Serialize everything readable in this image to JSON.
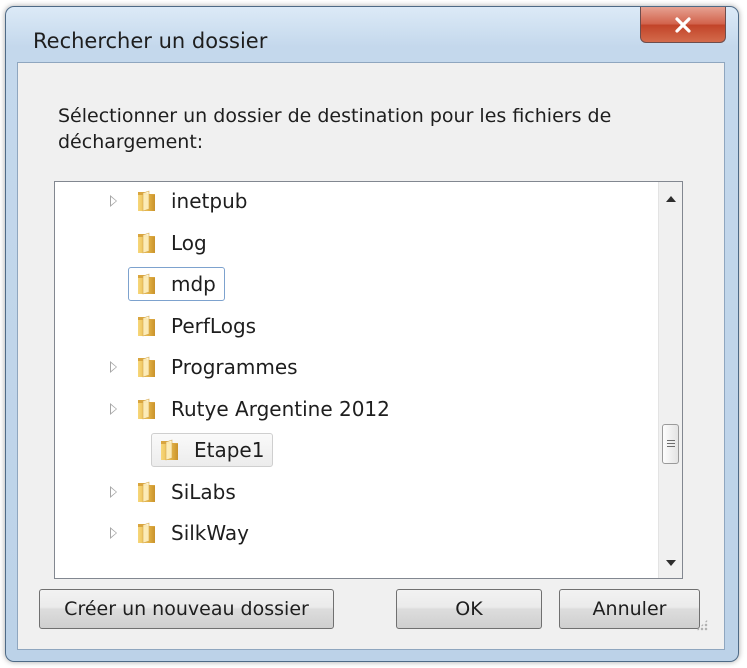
{
  "window": {
    "title": "Rechercher un dossier",
    "close_label": "close",
    "description": "Sélectionner un dossier de destination pour les fichiers de déchargement:"
  },
  "tree": {
    "items": [
      {
        "label": "inetpub",
        "expandable": true,
        "level": 1,
        "state": "normal"
      },
      {
        "label": "Log",
        "expandable": false,
        "level": 1,
        "state": "normal"
      },
      {
        "label": "mdp",
        "expandable": false,
        "level": 1,
        "state": "selected"
      },
      {
        "label": "PerfLogs",
        "expandable": false,
        "level": 1,
        "state": "normal"
      },
      {
        "label": "Programmes",
        "expandable": true,
        "level": 1,
        "state": "normal"
      },
      {
        "label": "Rutye Argentine 2012",
        "expandable": true,
        "level": 1,
        "state": "normal"
      },
      {
        "label": "Etape1",
        "expandable": false,
        "level": 2,
        "state": "hovered"
      },
      {
        "label": "SiLabs",
        "expandable": true,
        "level": 1,
        "state": "normal"
      },
      {
        "label": "SilkWay",
        "expandable": true,
        "level": 1,
        "state": "normal"
      }
    ]
  },
  "buttons": {
    "new_folder": "Créer un nouveau dossier",
    "ok": "OK",
    "cancel": "Annuler"
  },
  "colors": {
    "frame": "#c4d8ec",
    "close": "#c24429",
    "selection": "#7da2ce",
    "folder": "#e8b84a"
  }
}
